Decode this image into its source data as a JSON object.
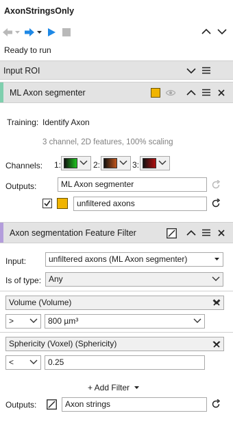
{
  "header": {
    "title": "AxonStringsOnly",
    "status": "Ready to run"
  },
  "input_roi": {
    "label": "Input ROI"
  },
  "segmenter": {
    "label": "ML Axon segmenter",
    "accent_color": "#7fcfae",
    "training_label": "Training:",
    "training_value": "Identify Axon",
    "features_info": "3 channel, 2D features, 100% scaling",
    "channels_label": "Channels:",
    "channels": [
      {
        "label": "1:",
        "color": "#1fc41f"
      },
      {
        "label": "2:",
        "color": "#c0541a"
      },
      {
        "label": "3:",
        "color": "#b01010"
      }
    ],
    "outputs_label": "Outputs:",
    "output_name": "ML Axon segmenter",
    "output_layer_name": "unfiltered axons",
    "output_layer_color": "#f0b400"
  },
  "feature_filter": {
    "label": "Axon segmentation Feature Filter",
    "accent_color": "#b39ddb",
    "input_label": "Input:",
    "input_value": "unfiltered axons (ML Axon segmenter)",
    "type_label": "Is of type:",
    "type_value": "Any",
    "filters": [
      {
        "feature": "Volume (Volume)",
        "operator": ">",
        "value": "800 µm³"
      },
      {
        "feature": "Sphericity (Voxel) (Sphericity)",
        "operator": "<",
        "value": "0.25"
      }
    ],
    "add_filter_label": "+ Add Filter",
    "outputs_label": "Outputs:",
    "output_name": "Axon strings"
  }
}
